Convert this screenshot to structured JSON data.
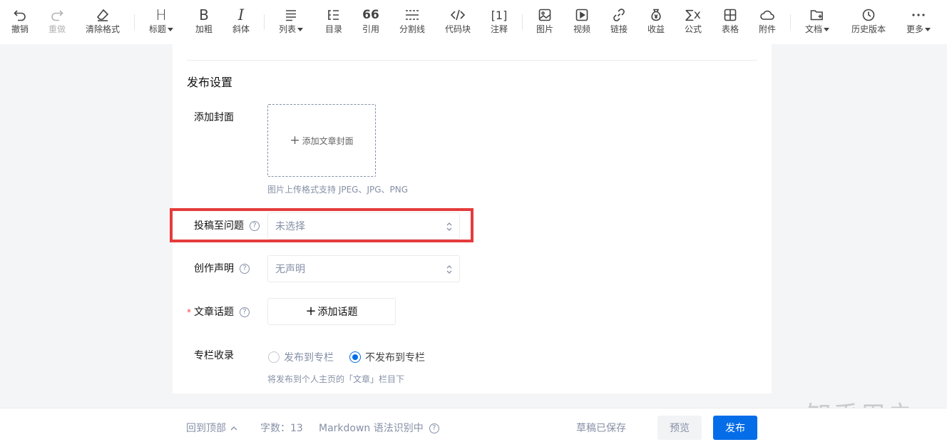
{
  "toolbar": {
    "undo": "撤销",
    "redo": "重做",
    "clear_format": "清除格式",
    "heading": "标题",
    "heading_glyph": "H",
    "bold": "加粗",
    "bold_glyph": "B",
    "italic": "斜体",
    "italic_glyph": "I",
    "list": "列表",
    "toc": "目录",
    "quote": "引用",
    "quote_glyph": "66",
    "divider": "分割线",
    "code_block": "代码块",
    "footnote": "注释",
    "footnote_glyph": "[1]",
    "image": "图片",
    "video": "视频",
    "link": "链接",
    "income": "收益",
    "formula": "公式",
    "formula_glyph": "∑x",
    "table": "表格",
    "attachment": "附件",
    "document": "文档",
    "history": "历史版本",
    "more": "更多"
  },
  "publish": {
    "section_title": "发布设置",
    "cover": {
      "label": "添加封面",
      "button": "添加文章封面",
      "hint": "图片上传格式支持 JPEG、JPG、PNG"
    },
    "question": {
      "label": "投稿至问题",
      "value": "未选择"
    },
    "declaration": {
      "label": "创作声明",
      "value": "无声明"
    },
    "topic": {
      "required_mark": "*",
      "label": "文章话题",
      "button": "添加话题"
    },
    "column": {
      "label": "专栏收录",
      "option_publish": "发布到专栏",
      "option_not_publish": "不发布到专栏",
      "selected": "不发布到专栏",
      "hint": "将发布到个人主页的「文章」栏目下"
    }
  },
  "footer": {
    "back_to_top": "回到顶部",
    "word_count": "字数：13",
    "markdown": "Markdown 语法识别中",
    "saved_status": "草稿已保存",
    "preview": "预览",
    "publish": "发布"
  },
  "watermark": "知乎用户",
  "colors": {
    "primary": "#056de8",
    "highlight": "#e53b3b",
    "required": "#f1403c"
  }
}
